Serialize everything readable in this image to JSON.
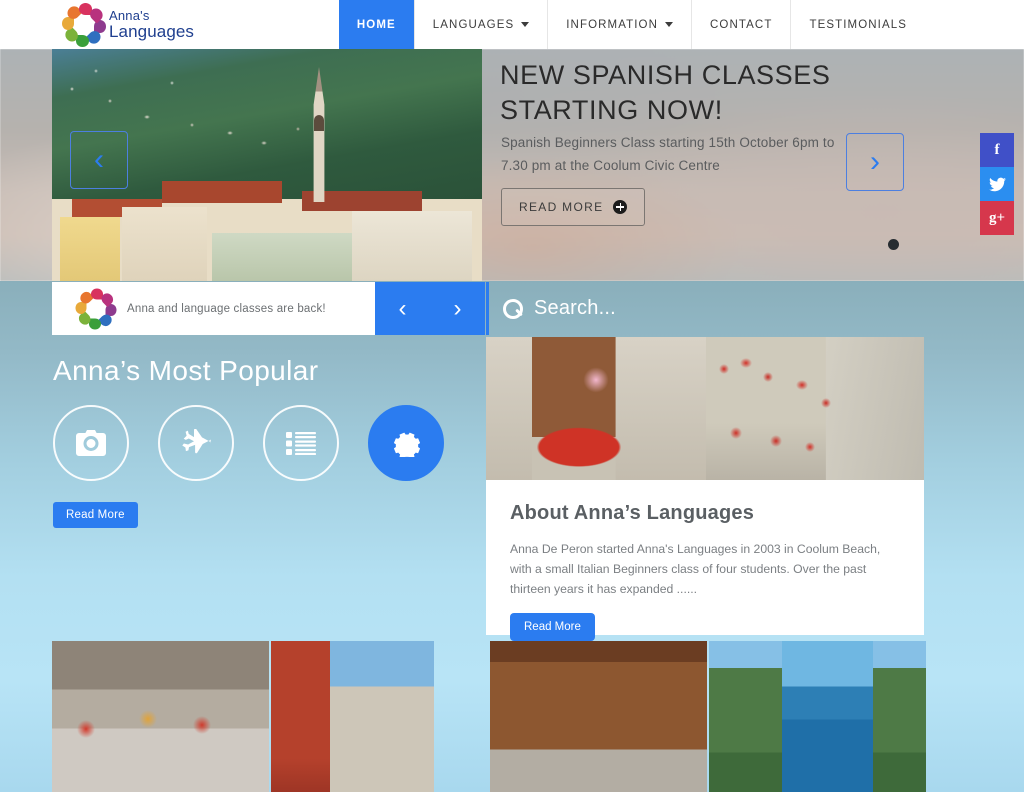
{
  "brand": {
    "name_line1": "Anna's",
    "name_line2": "Languages",
    "logo_icon": "pinwheel-speech-bubbles-logo",
    "primary_color": "#2b7cf0",
    "text_color": "#1f3f8f"
  },
  "nav": {
    "items": [
      {
        "label": "HOME",
        "active": true,
        "has_dropdown": false
      },
      {
        "label": "LANGUAGES",
        "active": false,
        "has_dropdown": true
      },
      {
        "label": "INFORMATION",
        "active": false,
        "has_dropdown": true
      },
      {
        "label": "CONTACT",
        "active": false,
        "has_dropdown": false
      },
      {
        "label": "TESTIMONIALS",
        "active": false,
        "has_dropdown": false
      }
    ]
  },
  "hero": {
    "title": "NEW SPANISH CLASSES STARTING NOW!",
    "subtitle": "Spanish Beginners Class starting 15th October 6pm to 7.30 pm at the Coolum Civic Centre",
    "cta_label": "READ MORE",
    "cta_icon": "plus-circle-icon",
    "prev_icon": "chevron-left-icon",
    "next_icon": "chevron-right-icon",
    "prev_glyph": "‹",
    "next_glyph": "›",
    "dots_count": 1,
    "active_dot": 1,
    "image_alt": "italian-lakeside-village-with-bell-tower"
  },
  "social": {
    "items": [
      {
        "name": "facebook",
        "glyph": "f",
        "color": "#4050c8"
      },
      {
        "name": "twitter",
        "glyph": "🐦",
        "color": "#2b8ef0"
      },
      {
        "name": "google-plus",
        "glyph": "g+",
        "color": "#d6374c"
      }
    ]
  },
  "ticker": {
    "logo_icon": "pinwheel-speech-bubbles-logo",
    "message": "Anna and language classes are back!",
    "prev_glyph": "‹",
    "next_glyph": "›"
  },
  "search": {
    "icon": "search-icon",
    "placeholder": "Search...",
    "value": ""
  },
  "popular": {
    "title": "Anna’s Most Popular",
    "icons": [
      {
        "name": "camera-icon",
        "filled": false
      },
      {
        "name": "airplane-icon",
        "filled": false
      },
      {
        "name": "list-icon",
        "filled": false
      },
      {
        "name": "gear-icon",
        "filled": true
      }
    ],
    "button_label": "Read More"
  },
  "about": {
    "image_alt": "woman-on-red-vespa-and-flowered-italian-alley",
    "title": "About Anna’s Languages",
    "body": "Anna De Peron started Anna's Languages  in 2003 in Coolum Beach, with a small Italian Beginners class of four students. Over the past thirteen years it has expanded ......",
    "button_label": "Read More"
  },
  "gallery": {
    "items": [
      {
        "name": "spanish-folk-dancers-in-street",
        "class": "g1"
      },
      {
        "name": "red-building-with-stairway-and-market-street",
        "class": "g2"
      },
      {
        "name": "boulangerie-le-pain-dhippolyte-shopfront",
        "class": "g3"
      },
      {
        "name": "capri-coastline-with-faraglioni-rocks",
        "class": "g4"
      }
    ]
  }
}
